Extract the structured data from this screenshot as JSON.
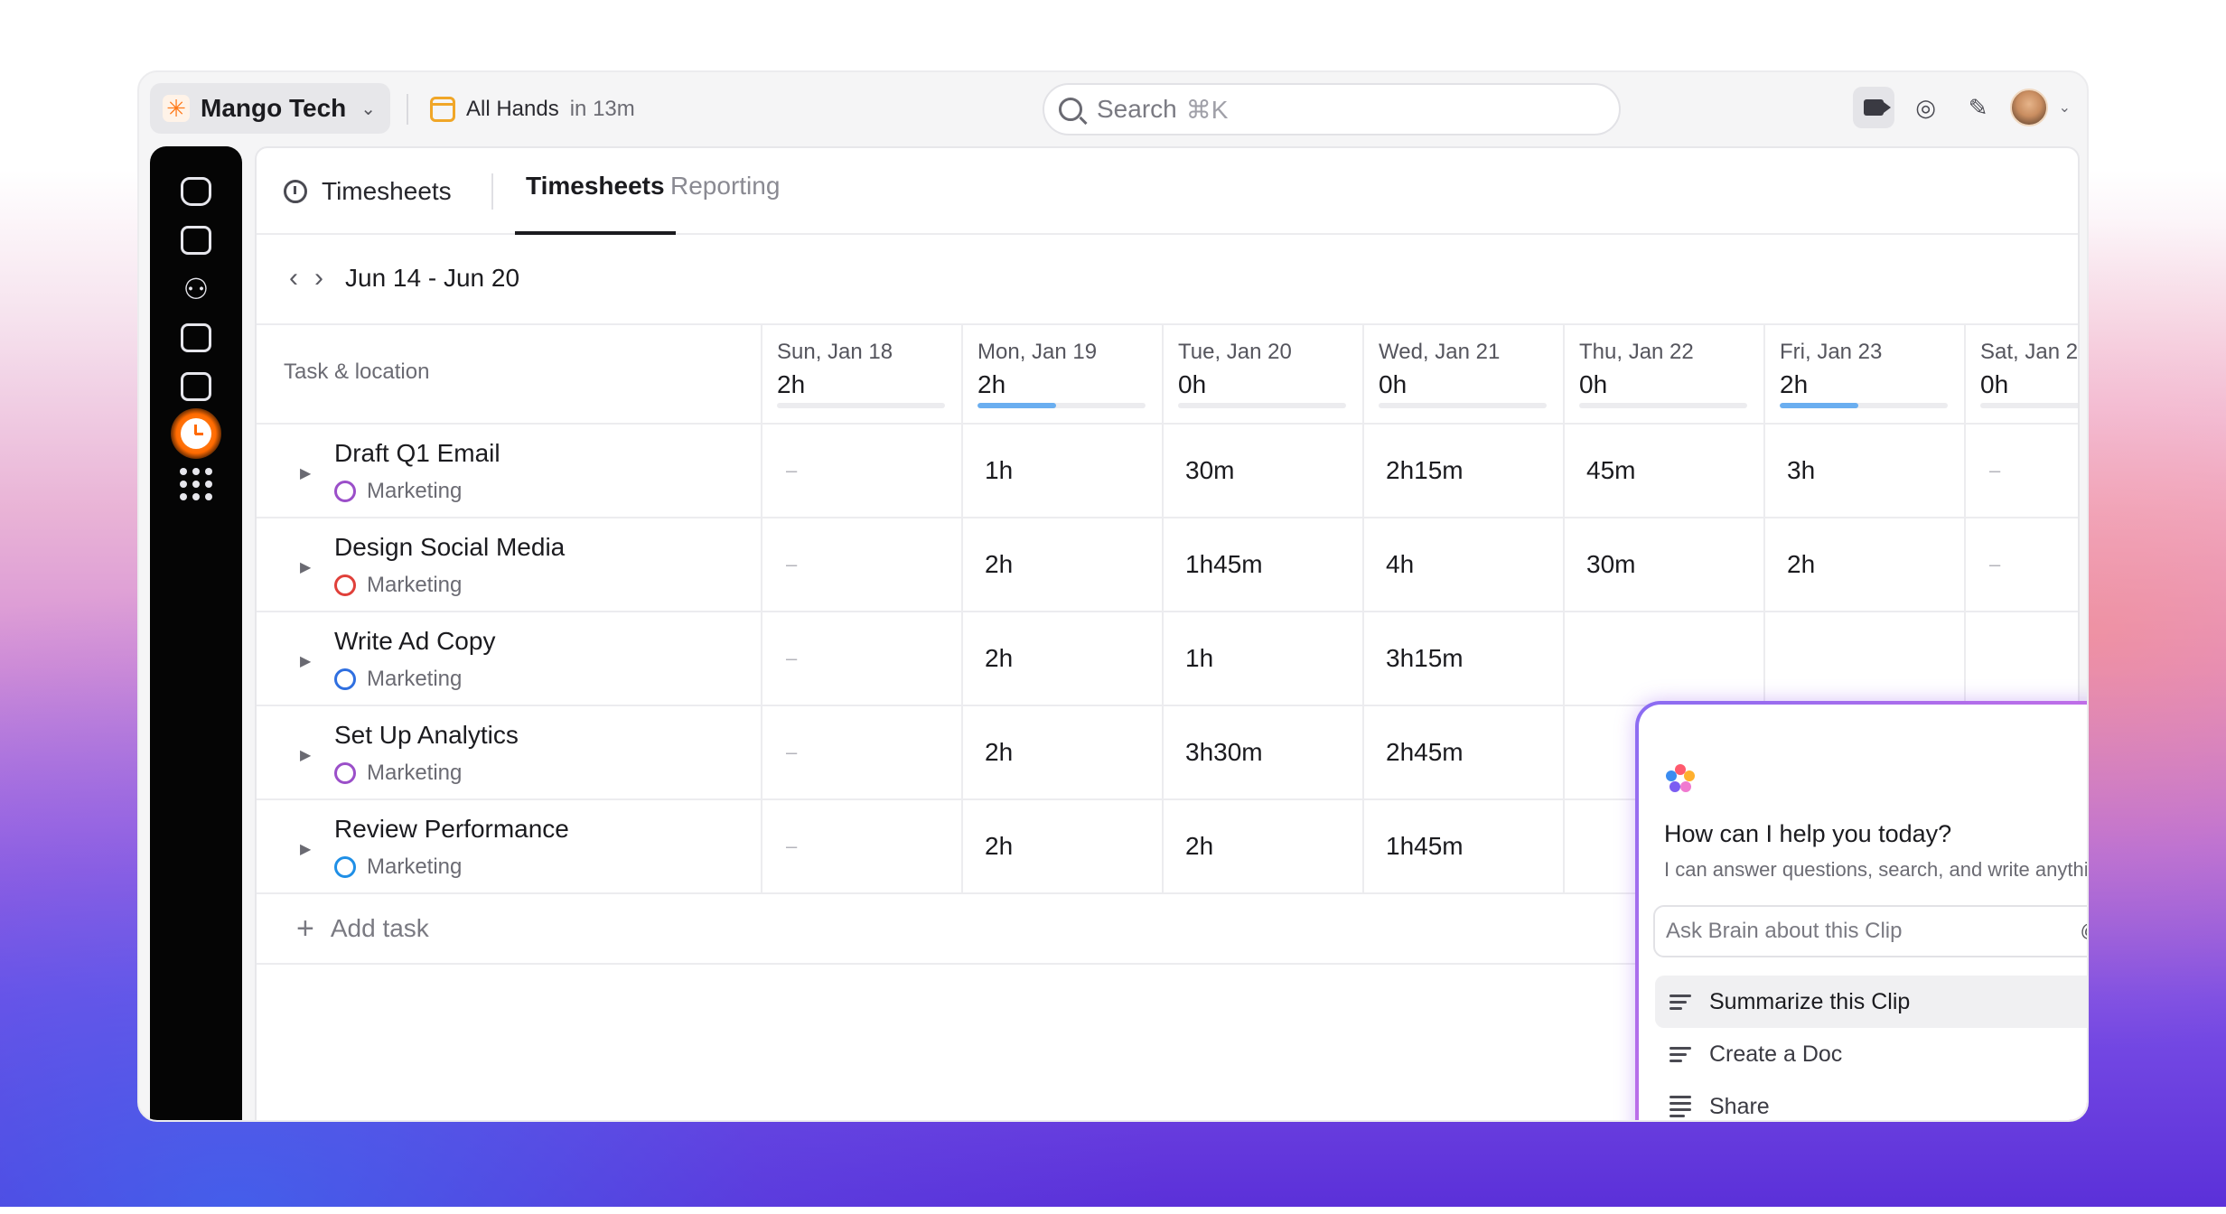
{
  "workspace": {
    "name": "Mango Tech"
  },
  "event": {
    "name": "All Hands",
    "time": "in 13m"
  },
  "search": {
    "placeholder": "Search",
    "shortcut": "⌘K"
  },
  "sidebar": {
    "items": [
      {
        "name": "home-icon"
      },
      {
        "name": "docs-icon"
      },
      {
        "name": "people-icon"
      },
      {
        "name": "dashboard-icon"
      },
      {
        "name": "whiteboard-icon"
      },
      {
        "name": "clock-icon",
        "active": true
      },
      {
        "name": "apps-grid-icon"
      }
    ]
  },
  "tabs": {
    "home_label": "Timesheets",
    "active_label": "Timesheets",
    "inactive_label": "Reporting"
  },
  "week": {
    "range": "Jun 14 - Jun 20"
  },
  "table": {
    "task_header": "Task & location",
    "days": [
      {
        "date": "Sun, Jan 18",
        "total": "2h",
        "progress": 0
      },
      {
        "date": "Mon, Jan 19",
        "total": "2h",
        "progress": 0.47
      },
      {
        "date": "Tue, Jan 20",
        "total": "0h",
        "progress": 0
      },
      {
        "date": "Wed, Jan 21",
        "total": "0h",
        "progress": 0
      },
      {
        "date": "Thu, Jan 22",
        "total": "0h",
        "progress": 0
      },
      {
        "date": "Fri, Jan 23",
        "total": "2h",
        "progress": 0.47
      },
      {
        "date": "Sat, Jan 2",
        "total": "0h",
        "progress": 0
      }
    ],
    "rows": [
      {
        "name": "Draft Q1 Email",
        "location": "Marketing",
        "loc_color": "#9b4fc9",
        "cells": [
          "–",
          "1h",
          "30m",
          "2h15m",
          "45m",
          "3h",
          "–"
        ]
      },
      {
        "name": "Design Social Media",
        "location": "Marketing",
        "loc_color": "#e0403a",
        "cells": [
          "–",
          "2h",
          "1h45m",
          "4h",
          "30m",
          "2h",
          "–"
        ]
      },
      {
        "name": "Write Ad Copy",
        "location": "Marketing",
        "loc_color": "#2f6fe0",
        "cells": [
          "–",
          "2h",
          "1h",
          "3h15m",
          "",
          "",
          ""
        ]
      },
      {
        "name": "Set Up Analytics",
        "location": "Marketing",
        "loc_color": "#9b4fc9",
        "cells": [
          "–",
          "2h",
          "3h30m",
          "2h45m",
          "",
          "",
          ""
        ]
      },
      {
        "name": "Review Performance",
        "location": "Marketing",
        "loc_color": "#1f8fe6",
        "cells": [
          "–",
          "2h",
          "2h",
          "1h45m",
          "",
          "",
          ""
        ]
      }
    ],
    "add_task": "Add task"
  },
  "brain": {
    "title": "How can I help you today?",
    "subtitle": "I can answer questions, search, and write anything.",
    "input_placeholder": "Ask Brain about this Clip",
    "actions": [
      "Summarize this Clip",
      "Create a Doc",
      "Share"
    ]
  },
  "colors": {
    "accent_orange": "#ff6a00",
    "progress_blue": "#6aaef0",
    "brain_gradient_start": "#8a6cf2",
    "brain_gradient_end": "#ff6a8a"
  }
}
